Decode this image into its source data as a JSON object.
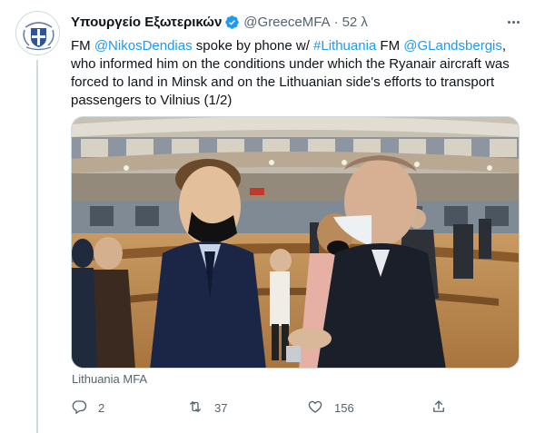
{
  "tweet": {
    "display_name": "Υπουργείο Εξωτερικών",
    "handle": "@GreeceMFA",
    "separator": "·",
    "time": "52 λ",
    "text": {
      "part1": "FM ",
      "mention1": "@NikosDendias",
      "part2": " spoke by phone w/ ",
      "hashtag": "#Lithuania",
      "part3": " FM ",
      "mention2": "@GLandsbergis",
      "part4": ", who informed him on the conditions under which the Ryanair aircraft was forced to land in Minsk and on the Lithuanian side's efforts to transport passengers to Vilnius (1/2)"
    },
    "media_attribution": "Lithuania MFA",
    "actions": {
      "reply_count": "2",
      "retweet_count": "37",
      "like_count": "156"
    }
  },
  "icons": {
    "avatar": "greek-coat-of-arms",
    "verified": "verified-badge-icon",
    "more": "more-icon",
    "reply": "reply-icon",
    "retweet": "retweet-icon",
    "like": "like-icon",
    "share": "share-icon"
  },
  "colors": {
    "link": "#1d9bf0",
    "secondary_text": "#536471",
    "primary_text": "#0f1419",
    "verified": "#1d9bf0",
    "border": "#cfd9de"
  }
}
